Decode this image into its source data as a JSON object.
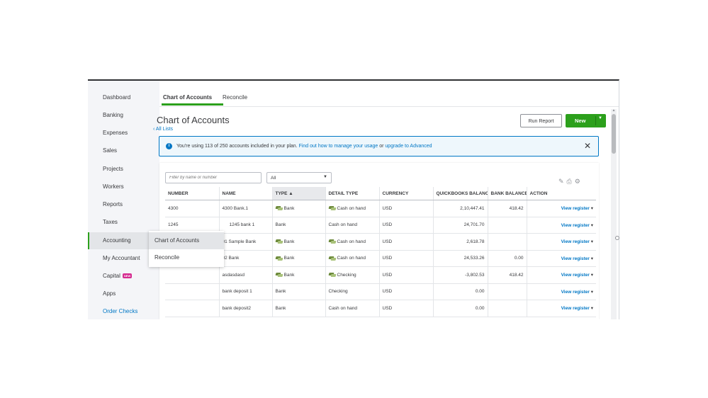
{
  "sidebar": {
    "items": [
      {
        "label": "Dashboard"
      },
      {
        "label": "Banking"
      },
      {
        "label": "Expenses"
      },
      {
        "label": "Sales"
      },
      {
        "label": "Projects"
      },
      {
        "label": "Workers"
      },
      {
        "label": "Reports"
      },
      {
        "label": "Taxes"
      },
      {
        "label": "Accounting"
      },
      {
        "label": "My Accountant"
      },
      {
        "label": "Capital",
        "badge": "NEW"
      },
      {
        "label": "Apps"
      },
      {
        "label": "Order Checks"
      }
    ],
    "active": "Accounting"
  },
  "flyout": {
    "items": [
      {
        "label": "Chart of Accounts"
      },
      {
        "label": "Reconcile"
      }
    ]
  },
  "tabs": [
    {
      "label": "Chart of Accounts"
    },
    {
      "label": "Reconcile"
    }
  ],
  "header": {
    "title": "Chart of Accounts",
    "back_link": "All Lists",
    "run_report": "Run Report",
    "new_button": "New"
  },
  "banner": {
    "text_prefix": "You're using 113 of 250 accounts included in your plan.",
    "link1": "Find out how to manage your usage",
    "middle": "or",
    "link2": "upgrade to Advanced"
  },
  "filter": {
    "placeholder": "Filter by name or number",
    "select_value": "All"
  },
  "table": {
    "columns": [
      "Number",
      "Name",
      "Type",
      "Detail Type",
      "Currency",
      "QuickBooks Balance",
      "Bank Balance",
      "Action"
    ],
    "rows": [
      {
        "number": "4300",
        "name": "4300 Bank.1",
        "type": "Bank",
        "detail": "Cash on hand",
        "currency": "USD",
        "qb_balance": "2,10,447.41",
        "bank_balance": "418.42",
        "action": "View register"
      },
      {
        "number": "1245",
        "name": "1245 bank 1",
        "type": "Bank",
        "detail": "Cash on hand",
        "currency": "USD",
        "qb_balance": "24,701.70",
        "bank_balance": "",
        "action": "View register"
      },
      {
        "number": "",
        "name": "01 Sample Bank",
        "type": "Bank",
        "detail": "Cash on hand",
        "currency": "USD",
        "qb_balance": "2,618.78",
        "bank_balance": "",
        "action": "View register"
      },
      {
        "number": "",
        "name": "02 Bank",
        "type": "Bank",
        "detail": "Cash on hand",
        "currency": "USD",
        "qb_balance": "24,533.26",
        "bank_balance": "0.00",
        "action": "View register"
      },
      {
        "number": "",
        "name": "asdasdasd",
        "type": "Bank",
        "detail": "Checking",
        "currency": "USD",
        "qb_balance": "-3,802.53",
        "bank_balance": "418.42",
        "action": "View register"
      },
      {
        "number": "",
        "name": "bank deposit 1",
        "type": "Bank",
        "detail": "Checking",
        "currency": "USD",
        "qb_balance": "0.00",
        "bank_balance": "",
        "action": "View register"
      },
      {
        "number": "",
        "name": "bank deposit2",
        "type": "Bank",
        "detail": "Cash on hand",
        "currency": "USD",
        "qb_balance": "0.00",
        "bank_balance": "",
        "action": "View register"
      }
    ]
  },
  "icons": {
    "sort": "sort-ascending-icon",
    "info": "info-icon",
    "close": "close-icon",
    "edit": "pencil-icon",
    "print": "printer-icon",
    "settings": "gear-icon",
    "money": "money-icon"
  },
  "colors": {
    "accent_green": "#2ca01c",
    "link_blue": "#0077c5",
    "badge_pink": "#d52b90"
  }
}
